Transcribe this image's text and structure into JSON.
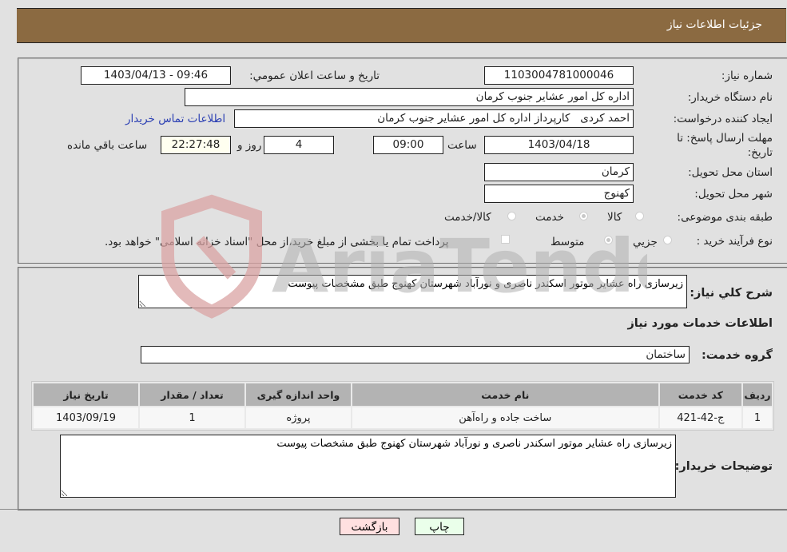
{
  "header": {
    "title": "جزئیات اطلاعات نیاز"
  },
  "fields": {
    "need_number": {
      "label": "شماره نیاز:",
      "value": "1103004781000046"
    },
    "announce_datetime": {
      "label": "تاریخ و ساعت اعلان عمومي:",
      "value": "1403/04/13 - 09:46"
    },
    "buyer_org": {
      "label": "نام دستگاه خريدار:",
      "value": "اداره کل امور عشایر جنوب کرمان"
    },
    "requester": {
      "label": "ايجاد کننده درخواست:",
      "value": "احمد کردی   کارپرداز اداره کل امور عشایر جنوب کرمان"
    },
    "buyer_contact_link": "اطلاعات تماس خريدار",
    "deadline": {
      "label_line1": "مهلت ارسال پاسخ: تا",
      "label_line2": "تاريخ:",
      "date": "1403/04/18",
      "time_label": "ساعت",
      "time": "09:00",
      "days": "4",
      "days_label": "روز و",
      "remaining": "22:27:48",
      "remaining_label": "ساعت باقي مانده"
    },
    "province": {
      "label": "استان محل تحويل:",
      "value": "کرمان"
    },
    "city": {
      "label": "شهر محل تحويل:",
      "value": "کهنوج"
    },
    "category": {
      "label": "طبقه بندی موضوعی:",
      "options": [
        "کالا",
        "خدمت",
        "کالا/خدمت"
      ],
      "selected": "خدمت"
    },
    "purchase_type": {
      "label": "نوع فرآيند خريد :",
      "options": [
        "جزيي",
        "متوسط"
      ],
      "selected": "متوسط",
      "treasury_note": "پرداخت تمام يا بخشی از مبلغ خريد،از محل \"اسناد خزانه اسلامی\" خواهد بود."
    }
  },
  "description": {
    "label": "شرح کلي نياز:",
    "value": "زیرسازی راه عشایر موتور اسکندر ناصری و نورآباد شهرستان کهنوج طبق مشخصات پیوست"
  },
  "services_section": {
    "title": "اطلاعات خدمات مورد نياز",
    "group_label": "گروه خدمت:",
    "group_value": "ساختمان",
    "table": {
      "headers": [
        "رديف",
        "کد خدمت",
        "نام خدمت",
        "واحد اندازه گيری",
        "تعداد / مقدار",
        "تاريخ نياز"
      ],
      "rows": [
        [
          "1",
          "ج-42-421",
          "ساخت جاده و راه‌آهن",
          "پروژه",
          "1",
          "1403/09/19"
        ]
      ]
    }
  },
  "buyer_notes": {
    "label": "توضيحات خريدار:",
    "value": "زیرسازی راه عشایر موتور اسکندر ناصری و نورآباد شهرستان کهنوج طبق مشخصات پیوست"
  },
  "buttons": {
    "print": "چاپ",
    "back": "بازگشت"
  },
  "colors": {
    "header_bg": "#8b6a41",
    "print_bg": "#eaffea",
    "back_bg": "#ffe0e0",
    "link": "#2b3fb3"
  },
  "watermark": "AriaTender.net"
}
